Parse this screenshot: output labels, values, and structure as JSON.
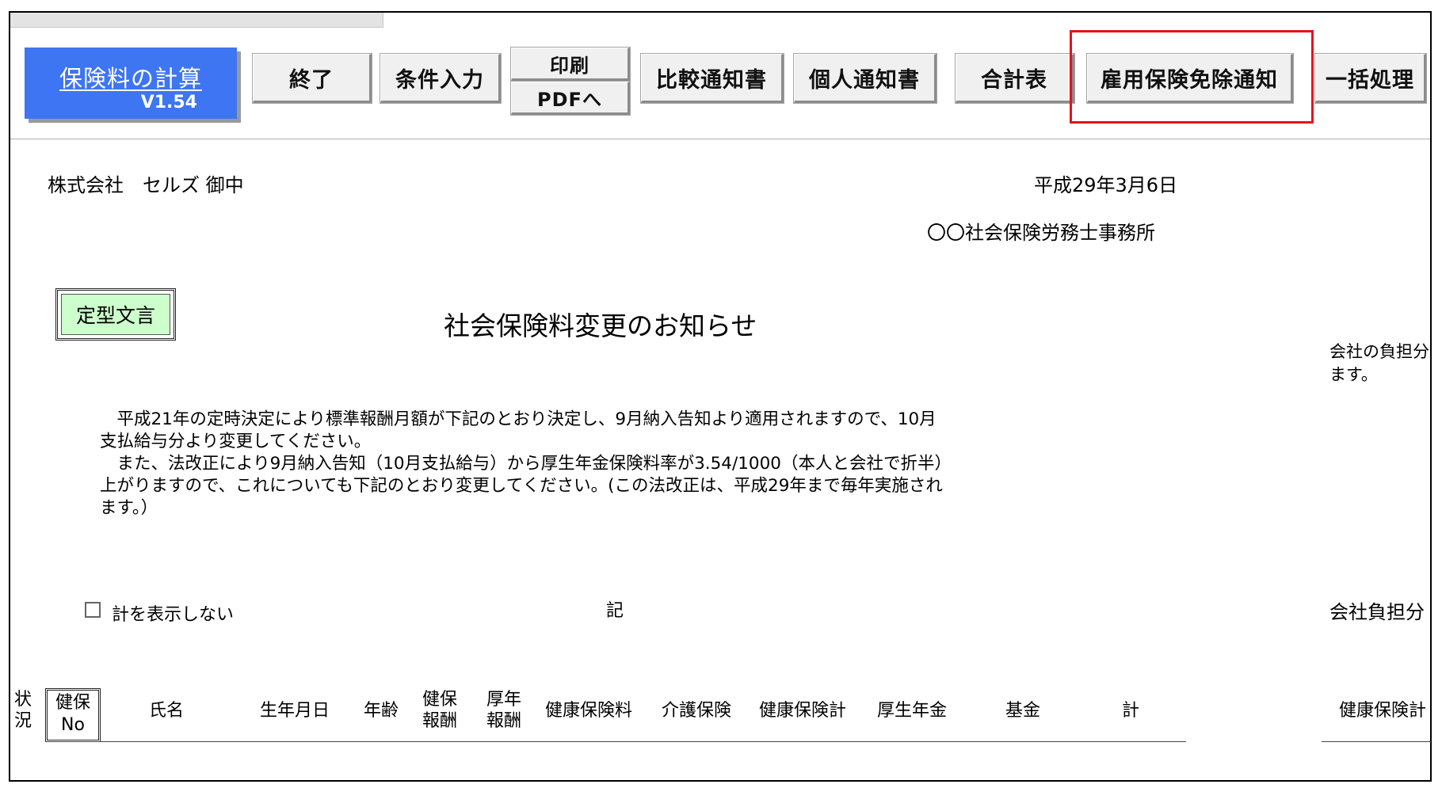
{
  "toolbar": {
    "calc_title": "保険料の計算",
    "calc_version": "V1.54",
    "end_label": "終了",
    "conditions_label": "条件入力",
    "print_label": "印刷",
    "pdf_label": "PDFへ",
    "compare_label": "比較通知書",
    "individual_label": "個人通知書",
    "total_label": "合計表",
    "exemption_label": "雇用保険免除通知",
    "batch_label": "一括処理"
  },
  "document": {
    "recipient": "株式会社　セルズ 御中",
    "date": "平成29年3月6日",
    "sender": "〇〇社会保険労務士事務所",
    "template_button": "定型文言",
    "title": "社会保険料変更のお知らせ",
    "side_note_line1": "会社の負担分",
    "side_note_line2": "ます。",
    "body_line1": "　平成21年の定時決定により標準報酬月額が下記のとおり決定し、9月納入告知より適用されますので、10月",
    "body_line2": "支払給与分より変更してください。",
    "body_line3": "　また、法改正により9月納入告知（10月支払給与）から厚生年金保険料率が3.54/1000（本人と会社で折半）",
    "body_line4": "上がりますので、これについても下記のとおり変更してください。(この法改正は、平成29年まで毎年実施され",
    "body_line5": "ます。）",
    "hide_total_label": "計を表示しない",
    "ki": "記",
    "company_share": "会社負担分"
  },
  "table": {
    "status_1": "状",
    "status_2": "況",
    "kenpo_1": "健保",
    "kenpo_2": "No",
    "name": "氏名",
    "birthdate": "生年月日",
    "age": "年齢",
    "kenpo_hoshu_1": "健保",
    "kenpo_hoshu_2": "報酬",
    "kosei_hoshu_1": "厚年",
    "kosei_hoshu_2": "報酬",
    "health_premium": "健康保険料",
    "nursing": "介護保険",
    "health_total": "健康保険計",
    "pension": "厚生年金",
    "fund": "基金",
    "total": "計",
    "health_total_company": "健康保険計"
  }
}
